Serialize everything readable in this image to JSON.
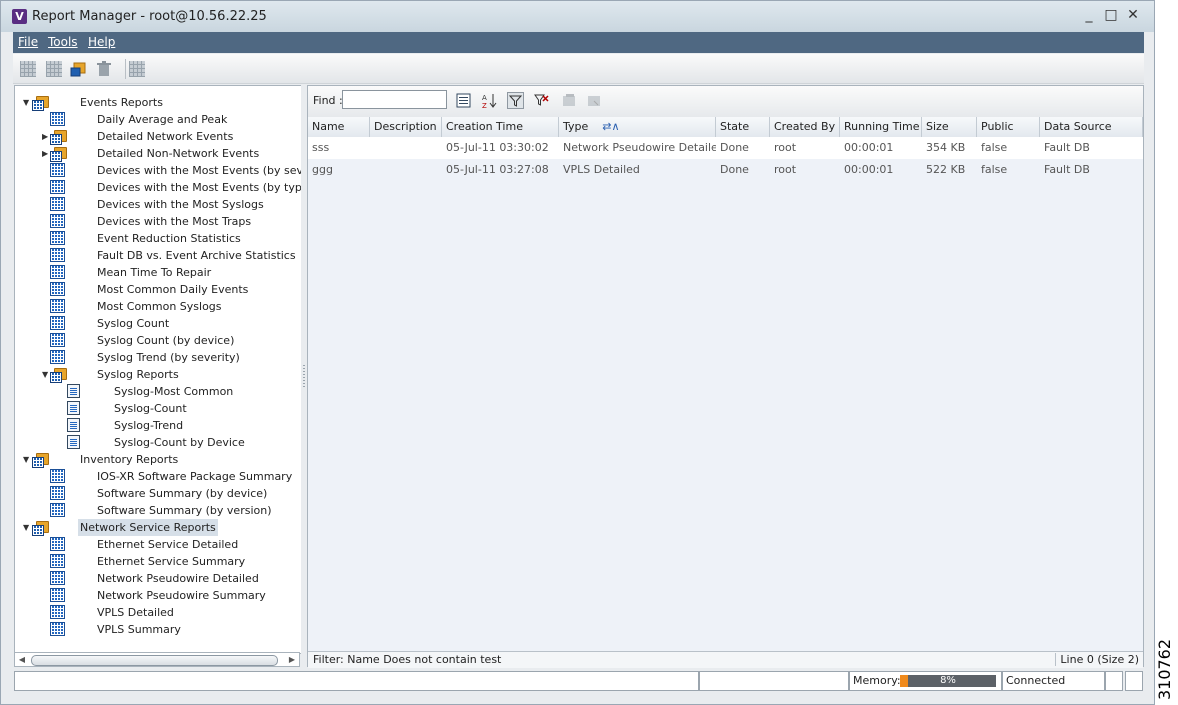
{
  "window": {
    "title": "Report Manager - root@10.56.22.25",
    "app_icon": "V",
    "controls": [
      "_",
      "□",
      "✕"
    ]
  },
  "menu": {
    "file": "File",
    "tools": "Tools",
    "help": "Help"
  },
  "tree": {
    "events_reports": {
      "label": "Events Reports",
      "items": [
        "Daily Average and Peak",
        "Detailed Network Events",
        "Detailed Non-Network Events",
        "Devices with the Most Events (by severity)",
        "Devices with the Most Events (by type)",
        "Devices with the Most Syslogs",
        "Devices with the Most Traps",
        "Event Reduction Statistics",
        "Fault DB vs. Event Archive Statistics",
        "Mean Time To Repair",
        "Most Common Daily Events",
        "Most Common Syslogs",
        "Syslog Count",
        "Syslog Count (by device)",
        "Syslog Trend (by severity)",
        "Syslog Reports"
      ],
      "syslog_children": [
        "Syslog-Most Common",
        "Syslog-Count",
        "Syslog-Trend",
        "Syslog-Count by Device"
      ]
    },
    "inventory_reports": {
      "label": "Inventory Reports",
      "items": [
        "IOS-XR Software Package Summary",
        "Software Summary (by device)",
        "Software Summary (by version)"
      ]
    },
    "network_service_reports": {
      "label": "Network Service Reports",
      "items": [
        "Ethernet Service Detailed",
        "Ethernet Service Summary",
        "Network Pseudowire Detailed",
        "Network Pseudowire Summary",
        "VPLS Detailed",
        "VPLS Summary"
      ]
    }
  },
  "find": {
    "label": "Find :",
    "value": ""
  },
  "table": {
    "columns": [
      "Name",
      "Description",
      "Creation Time",
      "Type",
      "State",
      "Created By",
      "Running Time",
      "Size",
      "Public",
      "Data Source"
    ],
    "rows": [
      [
        "sss",
        "",
        "05-Jul-11 03:30:02",
        "Network Pseudowire Detailed",
        "Done",
        "root",
        "00:00:01",
        "354 KB",
        "false",
        "Fault DB"
      ],
      [
        "ggg",
        "",
        "05-Jul-11 03:27:08",
        "VPLS Detailed",
        "Done",
        "root",
        "00:00:01",
        "522 KB",
        "false",
        "Fault DB"
      ]
    ],
    "sort_indicator": "⇄∧"
  },
  "status": {
    "filter": "Filter: Name Does not contain test",
    "line_info": "Line 0 (Size 2)"
  },
  "bottom": {
    "memory_label": "Memory:",
    "memory_percent": 8,
    "memory_text": "8%",
    "connection": "Connected"
  },
  "figure_id": "310762",
  "colors": {
    "menubar": "#4f6882",
    "selected": "#d6dfe8",
    "memory_fill": "#f08a1c"
  }
}
